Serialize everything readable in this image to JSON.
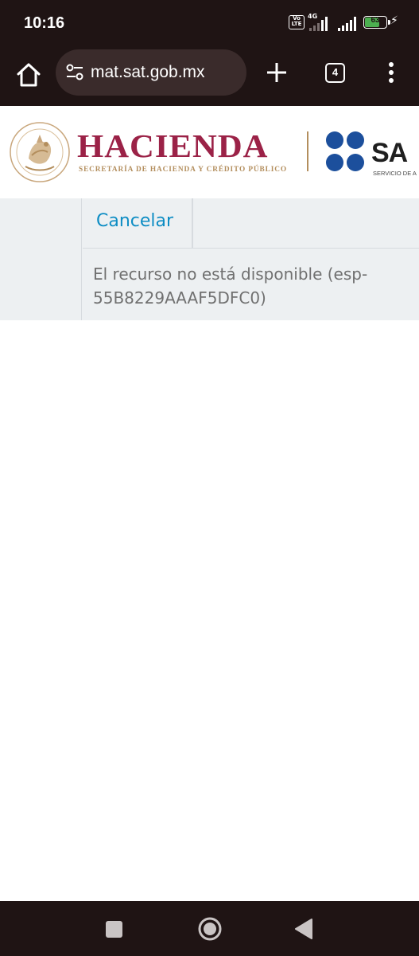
{
  "status_bar": {
    "time": "10:16",
    "volte_label": "Vo LTE",
    "network_type": "4G",
    "battery_percent": "63",
    "battery_level": 0.63,
    "charging_icon": "bolt-icon",
    "battery_color": "#4caf50"
  },
  "browser": {
    "home_icon": "home-icon",
    "site_settings_icon": "tune-icon",
    "url": "mat.sat.gob.mx",
    "new_tab_icon": "plus-icon",
    "tab_count": "4",
    "menu_icon": "more-vert-icon"
  },
  "header": {
    "hacienda_title": "HACIENDA",
    "hacienda_subtitle": "SECRETARÍA DE HACIENDA Y CRÉDITO PÚBLICO",
    "sat_title": "SA",
    "sat_subtitle": "SERVICIO DE A",
    "brand_color": "#9b2247",
    "gold_color": "#b38e5d",
    "sat_blue": "#1c4f9c"
  },
  "content": {
    "cancel_label": "Cancelar",
    "error_message": "El recurso no está disponible (esp-55B8229AAAF5DFC0)",
    "link_color": "#0e8dc4"
  },
  "nav_bar": {
    "recents_icon": "square-icon",
    "home_icon": "circle-icon",
    "back_icon": "triangle-back-icon"
  }
}
